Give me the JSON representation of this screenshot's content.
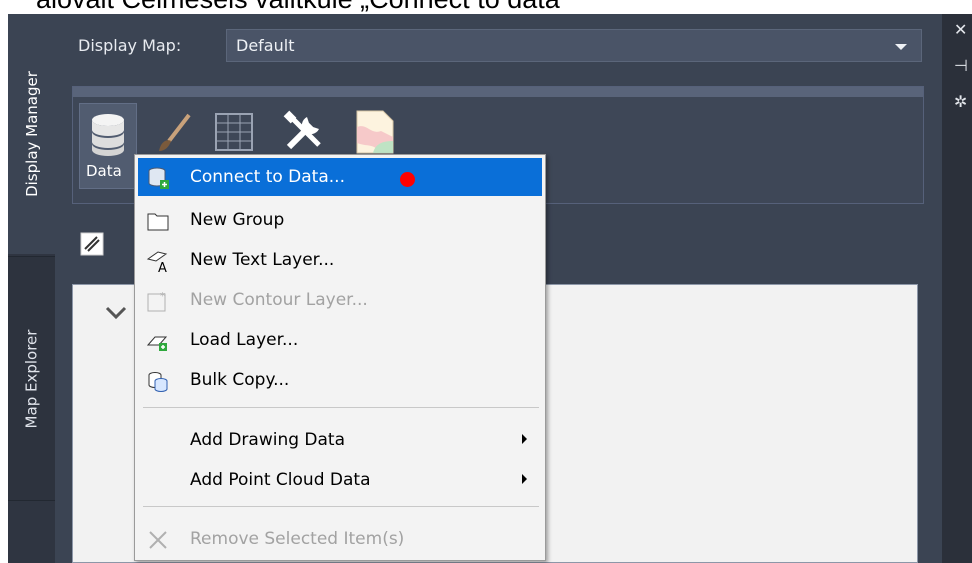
{
  "caption": "alovalt Celmeseis valitkule „Connect to data”",
  "tabs": {
    "display_manager": "Display Manager",
    "map_explorer": "Map Explorer"
  },
  "display_map": {
    "label": "Display Map:",
    "value": "Default"
  },
  "ribbon": {
    "data_label": "Data"
  },
  "menu": {
    "connect": "Connect to Data...",
    "new_group": "New Group",
    "new_text_layer": "New Text Layer...",
    "new_contour_layer": "New Contour Layer...",
    "load_layer": "Load Layer...",
    "bulk_copy": "Bulk Copy...",
    "add_drawing_data": "Add Drawing Data",
    "add_point_cloud_data": "Add Point Cloud Data",
    "remove_selected": "Remove Selected Item(s)"
  },
  "colors": {
    "highlight": "#0a6fd8",
    "marker": "#ff0000",
    "panel": "#3b4453"
  },
  "icons": {
    "data": "database-icon",
    "style": "brush-icon",
    "table": "table-icon",
    "tools": "tools-icon",
    "map": "map-icon"
  }
}
